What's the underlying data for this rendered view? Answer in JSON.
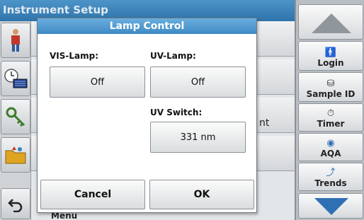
{
  "background": {
    "title": "Instrument Setup",
    "partial_text_timer_row": "nt",
    "partial_text_bottom": "Menu"
  },
  "sidebar": {
    "items": [
      {
        "label": "Login",
        "icon": "person-icon"
      },
      {
        "label": "Sample ID",
        "icon": "sample-vial-icon"
      },
      {
        "label": "Timer",
        "icon": "timer-icon"
      },
      {
        "label": "AQA",
        "icon": "aqa-icon"
      },
      {
        "label": "Trends",
        "icon": "trends-chart-icon"
      }
    ]
  },
  "dialog": {
    "title": "Lamp Control",
    "vis_lamp_label": "VIS-Lamp:",
    "vis_lamp_value": "Off",
    "uv_lamp_label": "UV-Lamp:",
    "uv_lamp_value": "Off",
    "uv_switch_label": "UV Switch:",
    "uv_switch_value": "331 nm",
    "cancel_label": "Cancel",
    "ok_label": "OK"
  },
  "colors": {
    "title_bar": "#2f74ab",
    "dialog_title": "#4a96cf",
    "arrow_blue": "#2f6fb4"
  }
}
